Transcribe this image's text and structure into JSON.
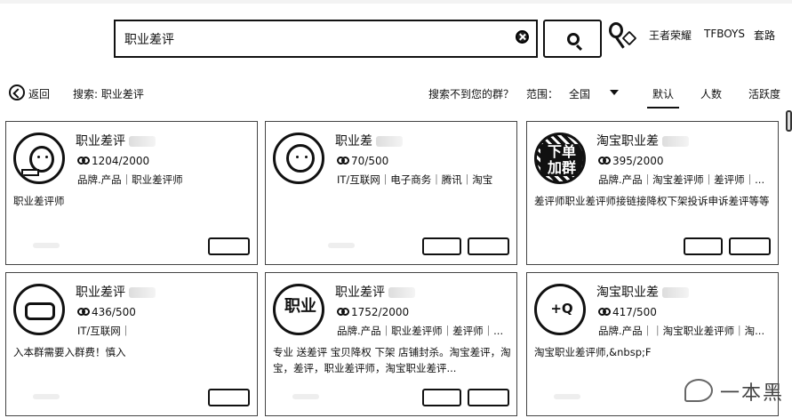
{
  "search": {
    "value": "职业差评"
  },
  "hot_links": [
    "王者荣耀",
    "TFBOYS",
    "套路"
  ],
  "filter": {
    "back_label": "返回",
    "search_label": "搜索: 职业差评",
    "not_found_label": "搜索不到您的群？",
    "range_label": "范围：",
    "range_value": "全国",
    "sort_options": [
      "默认",
      "人数",
      "活跃度"
    ],
    "active_sort": "默认"
  },
  "cards": [
    {
      "title": "职业差评",
      "members": "1204/2000",
      "tags": "品牌.产品｜职业差评师",
      "desc": "职业差评师",
      "avatar_text": ""
    },
    {
      "title": "职业差",
      "members": "70/500",
      "tags": "IT/互联网｜电子商务｜腾讯｜淘宝",
      "desc": "",
      "avatar_text": ""
    },
    {
      "title": "淘宝职业差",
      "members": "395/2000",
      "tags": "品牌.产品｜淘宝差评师｜差评师｜...",
      "desc": "差评师职业差评师接链接降权下架投诉申诉差评等等",
      "avatar_text": "下单 加群"
    },
    {
      "title": "职业差评",
      "members": "436/500",
      "tags": "IT/互联网｜",
      "desc": "入本群需要入群费！慎入",
      "avatar_text": ""
    },
    {
      "title": "职业差评",
      "members": "1752/2000",
      "tags": "品牌.产品｜职业差评师｜差评师｜...",
      "desc": "专业 送差评 宝贝降权 下架 店铺封杀。淘宝差评，淘宝，差评，职业差评师，淘宝职业差评...",
      "avatar_text": "职业"
    },
    {
      "title": "淘宝职业差",
      "members": "417/500",
      "tags": "品牌.产品｜｜淘宝职业差评师｜淘...",
      "desc": "淘宝职业差评师,&nbsp;F",
      "avatar_text": "+Q"
    }
  ],
  "buttons": {
    "view": "​",
    "join": "​"
  },
  "watermark": "一本黑"
}
